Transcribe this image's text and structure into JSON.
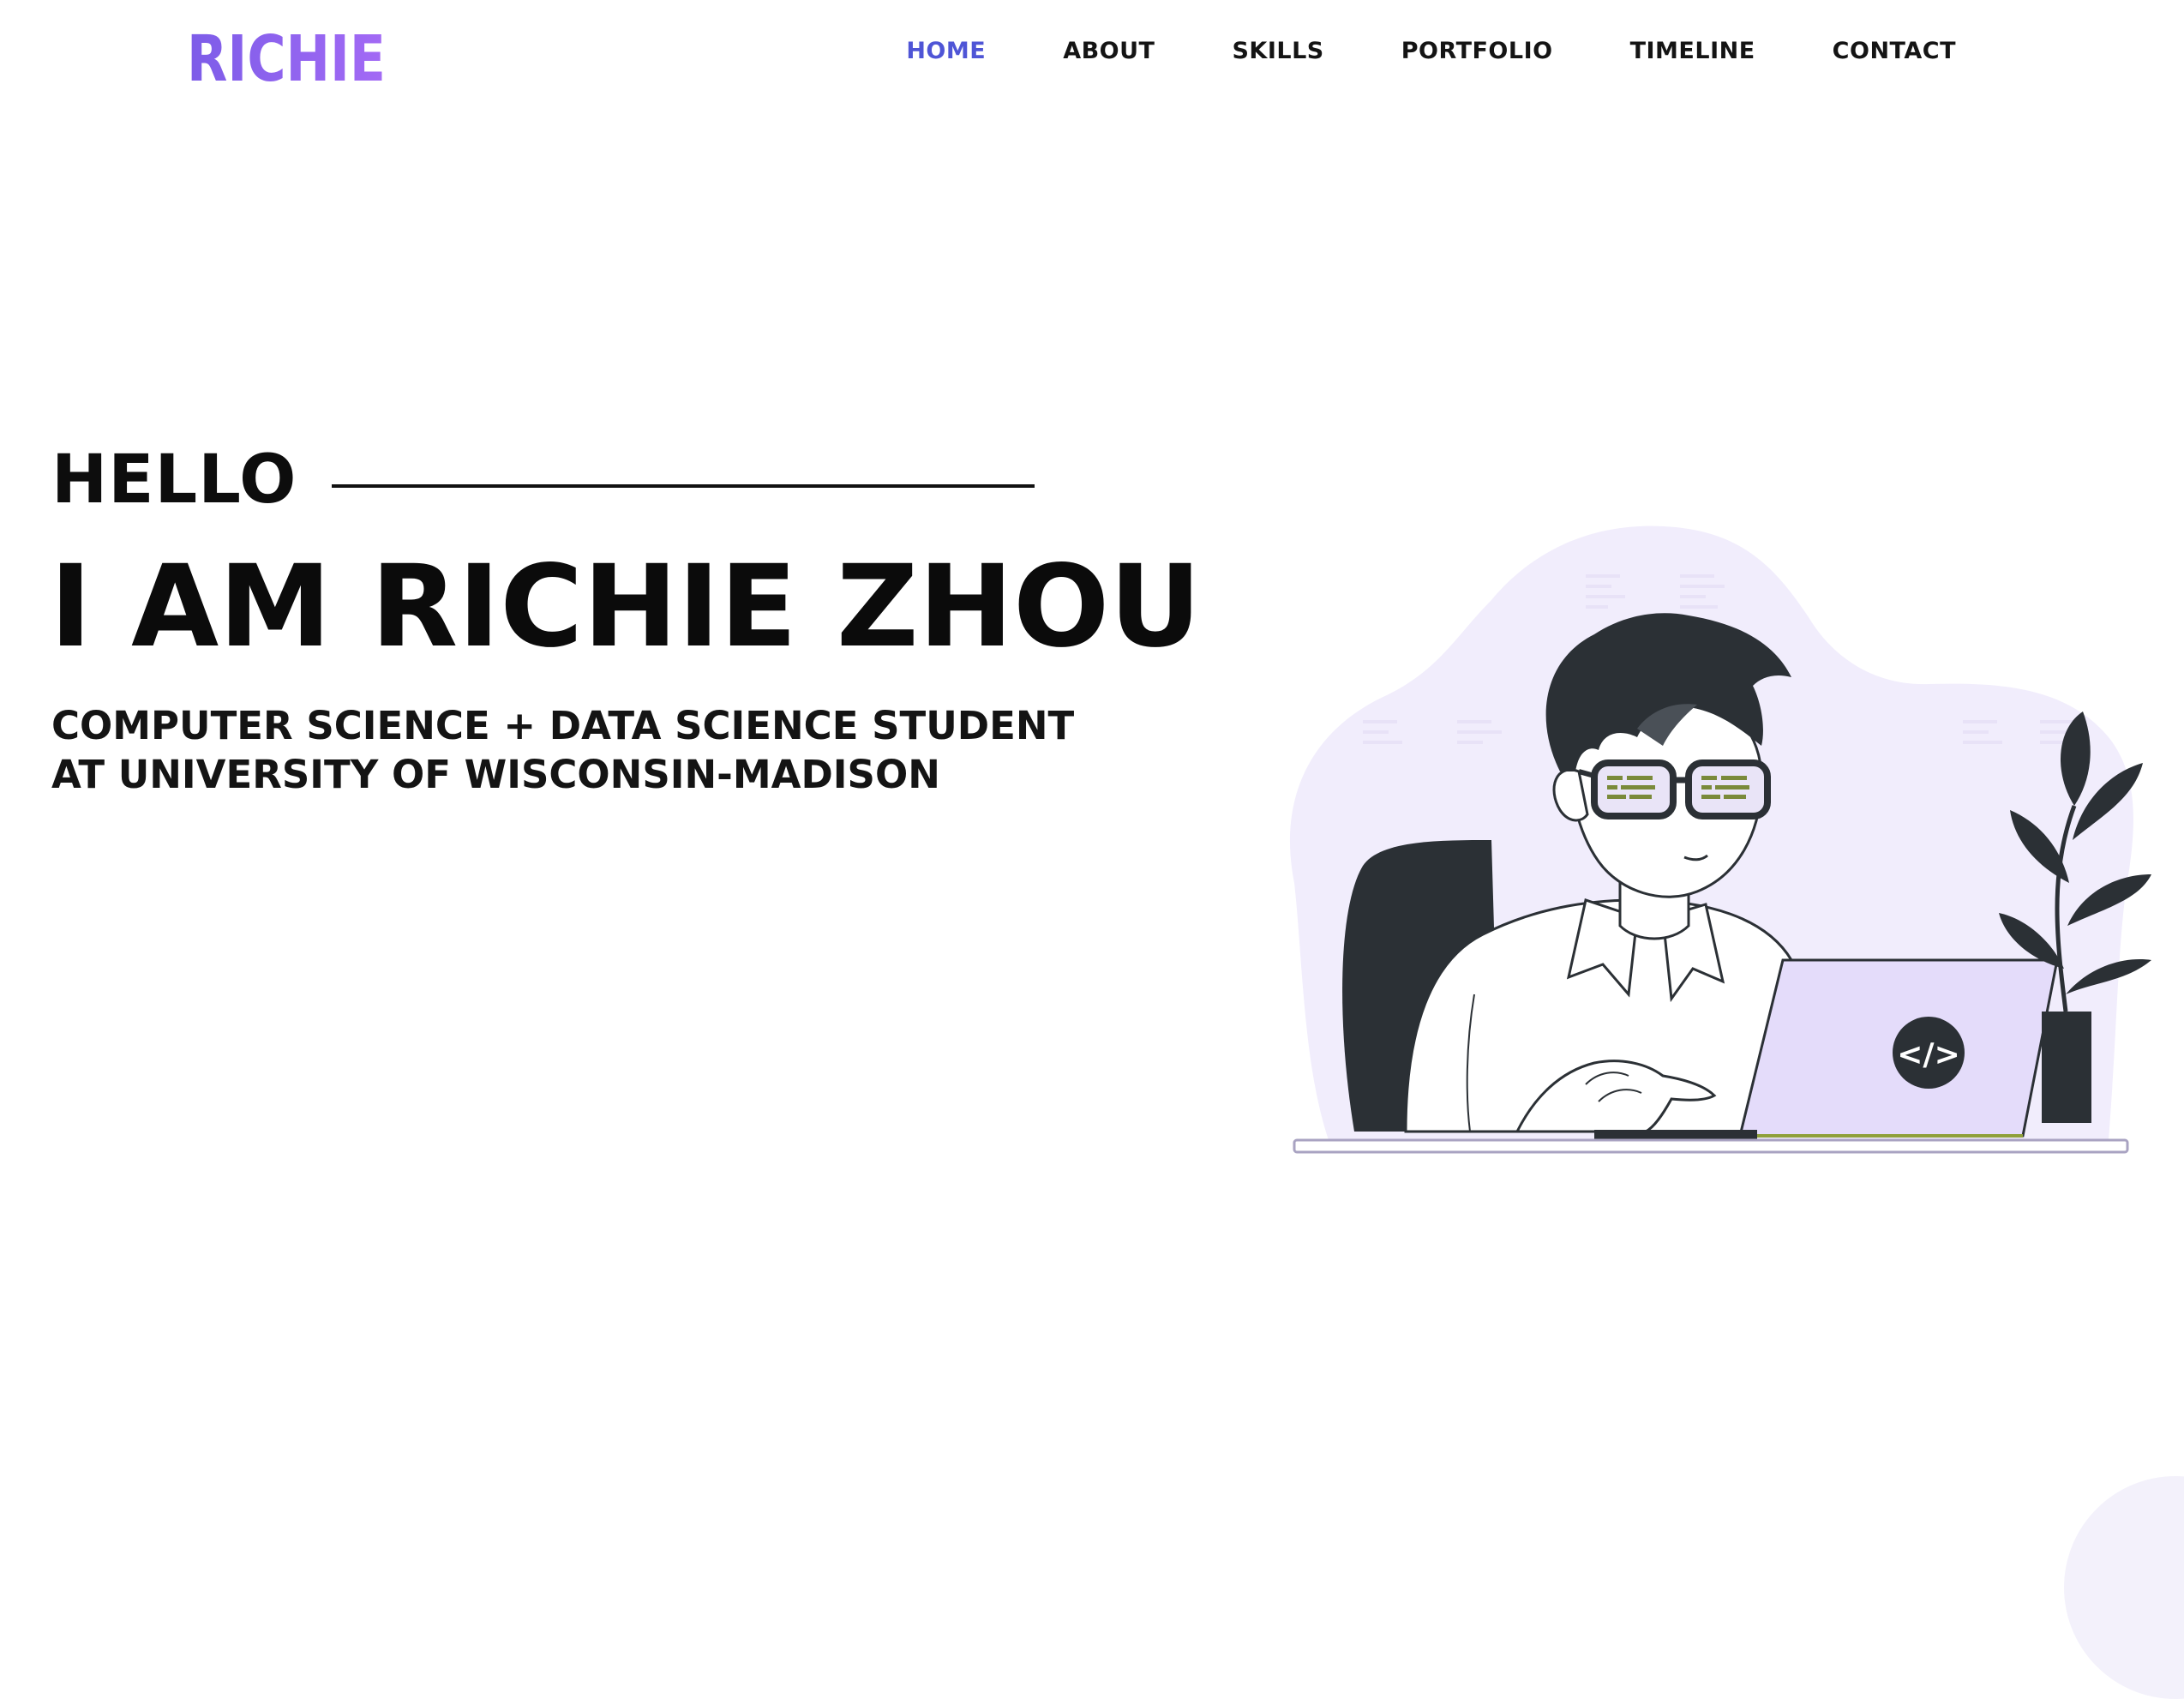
{
  "brand": {
    "logo_text": "RICHIE",
    "logo_color": "#8b5cf6"
  },
  "nav": {
    "items": [
      {
        "label": "HOME",
        "active": true
      },
      {
        "label": "ABOUT",
        "active": false
      },
      {
        "label": "SKILLS",
        "active": false
      },
      {
        "label": "PORTFOLIO",
        "active": false
      },
      {
        "label": "TIMELINE",
        "active": false
      },
      {
        "label": "CONTACT",
        "active": false
      }
    ],
    "active_color": "#4f55d6"
  },
  "hero": {
    "greeting": "HELLO",
    "title": "I AM RICHIE ZHOU",
    "subtitle": "COMPUTER SCIENCE + DATA SCIENCE STUDENT AT UNIVERSITY OF WISCONSIN-MADISON"
  },
  "illustration": {
    "laptop_badge": "</>",
    "blob_color": "#f1edfc",
    "dark_color": "#2b3035",
    "laptop_color": "#e4dcfa"
  }
}
